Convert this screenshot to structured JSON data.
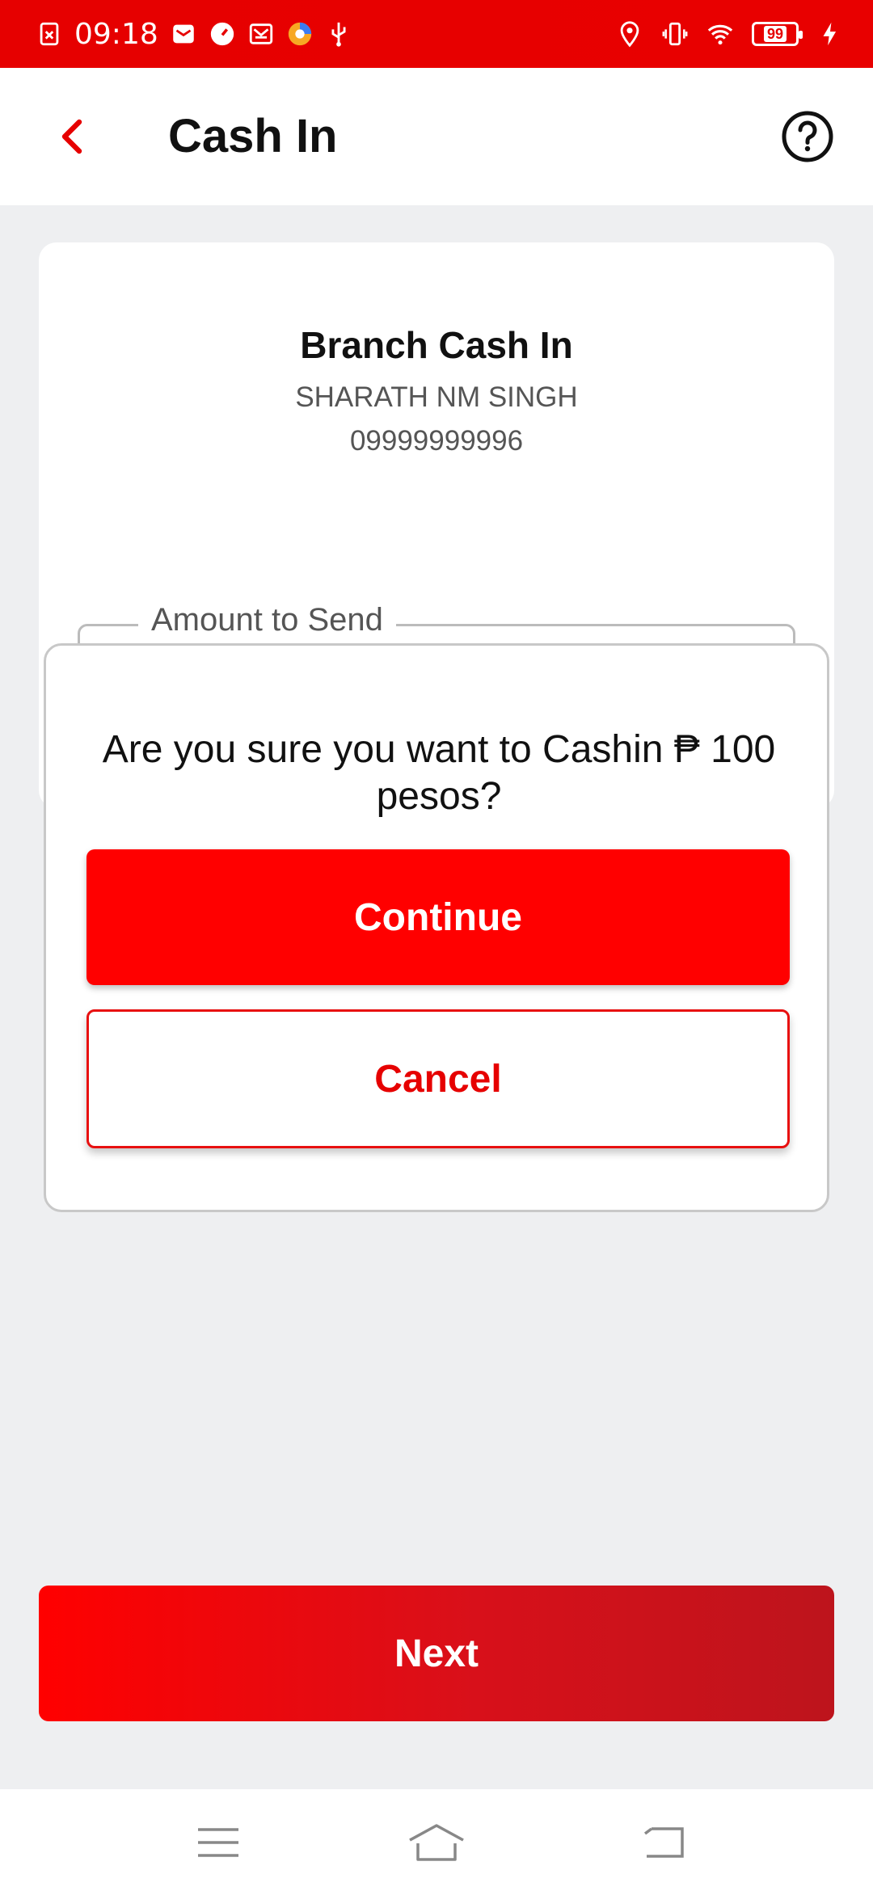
{
  "status_bar": {
    "time": "09:18",
    "battery": "99",
    "icons_left": [
      "screenshot-icon",
      "mail-icon",
      "speedometer-icon",
      "message-icon",
      "browser-icon",
      "usb-icon"
    ],
    "icons_right": [
      "location-icon",
      "vibrate-icon",
      "wifi-icon",
      "battery-icon",
      "charging-icon"
    ]
  },
  "header": {
    "title": "Cash In",
    "back_icon": "chevron-left-icon",
    "help_icon": "help-circle-icon"
  },
  "card": {
    "title": "Branch Cash In",
    "name": "SHARATH NM SINGH",
    "phone": "09999999996",
    "amount_label": "Amount to Send"
  },
  "dialog": {
    "message": "Are you sure you want to Cashin ₱ 100 pesos?",
    "continue_label": "Continue",
    "cancel_label": "Cancel"
  },
  "footer": {
    "next_label": "Next"
  },
  "nav": {
    "icons": [
      "menu-icon",
      "home-icon",
      "back-icon"
    ]
  },
  "colors": {
    "brand_red": "#ff0000",
    "status_bar": "#e60000",
    "background": "#eeeff1"
  }
}
